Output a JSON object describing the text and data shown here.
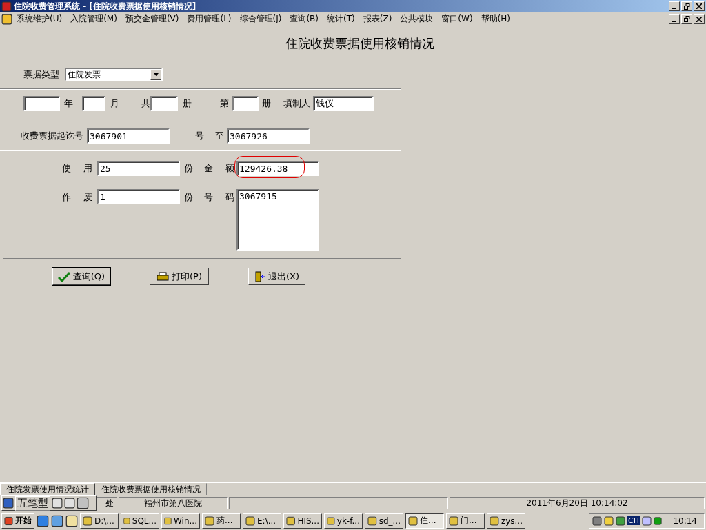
{
  "window": {
    "title": "住院收费管理系统 - [住院收费票据使用核销情况]"
  },
  "menu": [
    "系统维护(U)",
    "入院管理(M)",
    "预交金管理(V)",
    "费用管理(L)",
    "综合管理(J)",
    "查询(B)",
    "统计(T)",
    "报表(Z)",
    "公共模块",
    "窗口(W)",
    "帮助(H)"
  ],
  "form": {
    "title": "住院收费票据使用核销情况",
    "ticket_type": {
      "label": "票据类型",
      "value": "住院发票"
    },
    "period": {
      "year_label": "年",
      "month_label": "月",
      "total_label": "共",
      "total_unit": "册",
      "volume_label": "第",
      "volume_unit": "册",
      "preparer_label": "填制人",
      "preparer": "钱仪"
    },
    "range": {
      "label": "收费票据起讫号",
      "start": "3067901",
      "mid_label": "号",
      "to_label": "至",
      "end": "3067926"
    },
    "used": {
      "label": "使 用",
      "count": "25",
      "unit": "份",
      "amount_label": "金 额",
      "amount": "129426.38"
    },
    "voided": {
      "label": "作 废",
      "count": "1",
      "unit": "份",
      "numbers_label": "号 码",
      "numbers": "3067915"
    },
    "buttons": [
      {
        "kind": "check",
        "label": "查询(Q)",
        "selected": true
      },
      {
        "kind": "print",
        "label": "打印(P)",
        "selected": false
      },
      {
        "kind": "exit",
        "label": "退出(X)",
        "selected": false
      }
    ]
  },
  "window_tabs": [
    {
      "label": "住院发票使用情况统计",
      "selected": true
    },
    {
      "label": "住院收费票据使用核销情况",
      "selected": false
    }
  ],
  "ime": {
    "label": "五笔型"
  },
  "status_bar": [
    "处",
    "福州市第八医院",
    "2011年6月20日 10:14:02"
  ],
  "taskbar": {
    "start": "开始",
    "tasks": [
      {
        "label": "D:\\...",
        "selected": false
      },
      {
        "label": "SQL...",
        "selected": false
      },
      {
        "label": "Win...",
        "selected": false
      },
      {
        "label": "药...",
        "selected": false
      },
      {
        "label": "E:\\...",
        "selected": false
      },
      {
        "label": "HIS...",
        "selected": false
      },
      {
        "label": "yk-f...",
        "selected": false
      },
      {
        "label": "sd_...",
        "selected": false
      },
      {
        "label": "住...",
        "selected": true
      },
      {
        "label": "门...",
        "selected": false
      },
      {
        "label": "zys...",
        "selected": false
      }
    ],
    "lang": "CH",
    "clock": "10:14"
  }
}
